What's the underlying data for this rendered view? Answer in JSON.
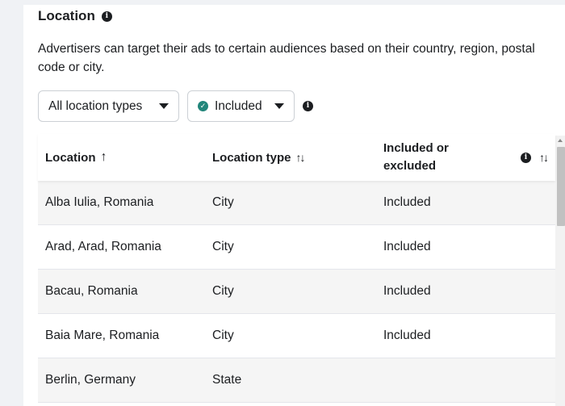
{
  "section": {
    "title": "Location",
    "description": "Advertisers can target their ads to certain audiences based on their country, region, postal code or city."
  },
  "filters": {
    "location_types": "All location types",
    "inclusion": "Included"
  },
  "table": {
    "headers": {
      "location": "Location",
      "location_type": "Location type",
      "included_line1": "Included or",
      "included_line2": "excluded"
    },
    "rows": [
      {
        "location": "Alba Iulia, Romania",
        "type": "City",
        "status": "Included"
      },
      {
        "location": "Arad, Arad, Romania",
        "type": "City",
        "status": "Included"
      },
      {
        "location": "Bacau, Romania",
        "type": "City",
        "status": "Included"
      },
      {
        "location": "Baia Mare, Romania",
        "type": "City",
        "status": "Included"
      },
      {
        "location": "Berlin, Germany",
        "type": "State",
        "status": ""
      }
    ]
  },
  "icons": {
    "info": "info-icon",
    "caret": "chevron-down-icon",
    "check": "check-circle-icon",
    "sort_asc": "arrow-up-icon",
    "sort": "sort-icon"
  },
  "colors": {
    "accent_check": "#21857a",
    "row_stripe": "#f5f5f5",
    "text": "#1c1e21"
  }
}
